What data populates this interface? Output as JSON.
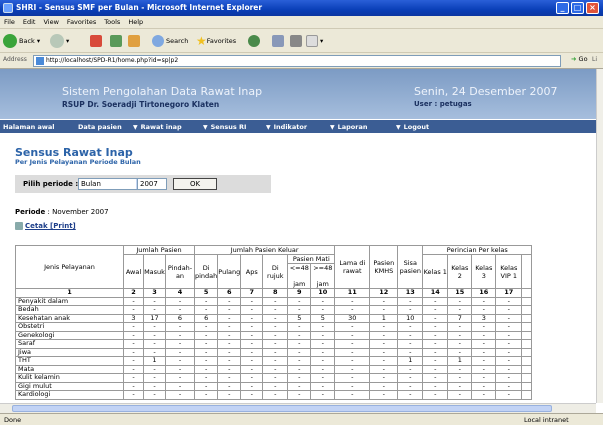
{
  "window": {
    "title": "SHRI - Sensus SMF per Bulan - Microsoft Internet Explorer"
  },
  "menu": [
    "File",
    "Edit",
    "View",
    "Favorites",
    "Tools",
    "Help"
  ],
  "toolbar": {
    "back": "Back",
    "search": "Search",
    "favorites": "Favorites"
  },
  "address": {
    "label": "Address",
    "url": "http://localhost/SPD-R1/home.php?id=sp|p2",
    "go": "Go",
    "links": "Li"
  },
  "header": {
    "title": "Sistem Pengolahan Data Rawat Inap",
    "subtitle": "RSUP Dr. Soeradji Tirtonegoro Klaten",
    "date": "Senin, 24 Desember 2007",
    "user": "User : petugas"
  },
  "nav": [
    {
      "label": "Halaman awal"
    },
    {
      "label": "Data pasien"
    },
    {
      "label": "Rawat inap"
    },
    {
      "label": "Sensus RI"
    },
    {
      "label": "Indikator"
    },
    {
      "label": "Laporan"
    },
    {
      "label": "Logout"
    }
  ],
  "page": {
    "title": "Sensus Rawat Inap",
    "subtitle": "Per Jenis Pelayanan Periode Bulan",
    "filter_label": "Pilih periode :",
    "period_value": "Bulan",
    "year_value": "2007",
    "ok": "OK",
    "periode_label": "Periode",
    "periode_value": ": November 2007",
    "print": "Cetak [Print]"
  },
  "table": {
    "h_jenis": "Jenis Pelayanan",
    "h_jumlah": "Jumlah Pasien",
    "h_keluar": "Jumlah Pasien Keluar",
    "h_mati": "Pasien Mati",
    "h_rincian": "Perincian Per kelas",
    "h_awal": "Awal",
    "h_masuk": "Masuk",
    "h_pindahan": "Pindah-an",
    "h_dipindah": "Di pindah",
    "h_pulang": "Pulang",
    "h_aps": "Aps",
    "h_dirujuk": "Di rujuk",
    "h_lt48": "<=48",
    "h_gt48": ">=48",
    "h_jam1": "jam",
    "h_jam2": "jam",
    "h_lama": "Lama di rawat",
    "h_kmhs": "Pasien KMHS",
    "h_sisa": "Sisa pasien",
    "h_k1": "Kelas 1",
    "h_k2": "Kelas 2",
    "h_k3": "Kelas 3",
    "h_vip1": "Kelas VIP 1",
    "numbers": [
      "1",
      "2",
      "3",
      "4",
      "5",
      "6",
      "7",
      "8",
      "9",
      "10",
      "11",
      "12",
      "13",
      "14",
      "15",
      "16",
      "17"
    ],
    "rows": [
      {
        "name": "Penyakit dalam",
        "v": [
          "-",
          "-",
          "-",
          "-",
          "-",
          "-",
          "-",
          "-",
          "-",
          "-",
          "-",
          "-",
          "-",
          "-",
          "-",
          "-"
        ]
      },
      {
        "name": "Bedah",
        "v": [
          "-",
          "-",
          "-",
          "-",
          "-",
          "-",
          "-",
          "-",
          "-",
          "-",
          "-",
          "-",
          "-",
          "-",
          "-",
          "-"
        ]
      },
      {
        "name": "Kesehatan anak",
        "v": [
          "3",
          "17",
          "6",
          "6",
          "-",
          "-",
          "-",
          "5",
          "5",
          "30",
          "1",
          "10",
          "-",
          "7",
          "3",
          "-"
        ]
      },
      {
        "name": "Obstetri",
        "v": [
          "-",
          "-",
          "-",
          "-",
          "-",
          "-",
          "-",
          "-",
          "-",
          "-",
          "-",
          "-",
          "-",
          "-",
          "-",
          "-"
        ]
      },
      {
        "name": "Genekologi",
        "v": [
          "-",
          "-",
          "-",
          "-",
          "-",
          "-",
          "-",
          "-",
          "-",
          "-",
          "-",
          "-",
          "-",
          "-",
          "-",
          "-"
        ]
      },
      {
        "name": "Saraf",
        "v": [
          "-",
          "-",
          "-",
          "-",
          "-",
          "-",
          "-",
          "-",
          "-",
          "-",
          "-",
          "-",
          "-",
          "-",
          "-",
          "-"
        ]
      },
      {
        "name": "Jiwa",
        "v": [
          "-",
          "-",
          "-",
          "-",
          "-",
          "-",
          "-",
          "-",
          "-",
          "-",
          "-",
          "-",
          "-",
          "-",
          "-",
          "-"
        ]
      },
      {
        "name": "THT",
        "v": [
          "-",
          "1",
          "-",
          "-",
          "-",
          "-",
          "-",
          "-",
          "-",
          "-",
          "-",
          "1",
          "-",
          "1",
          "-",
          "-"
        ]
      },
      {
        "name": "Mata",
        "v": [
          "-",
          "-",
          "-",
          "-",
          "-",
          "-",
          "-",
          "-",
          "-",
          "-",
          "-",
          "-",
          "-",
          "-",
          "-",
          "-"
        ]
      },
      {
        "name": "Kulit kelamin",
        "v": [
          "-",
          "-",
          "-",
          "-",
          "-",
          "-",
          "-",
          "-",
          "-",
          "-",
          "-",
          "-",
          "-",
          "-",
          "-",
          "-"
        ]
      },
      {
        "name": "Gigi mulut",
        "v": [
          "-",
          "-",
          "-",
          "-",
          "-",
          "-",
          "-",
          "-",
          "-",
          "-",
          "-",
          "-",
          "-",
          "-",
          "-",
          "-"
        ]
      },
      {
        "name": "Kardiologi",
        "v": [
          "-",
          "-",
          "-",
          "-",
          "-",
          "-",
          "-",
          "-",
          "-",
          "-",
          "-",
          "-",
          "-",
          "-",
          "-",
          "-"
        ]
      }
    ]
  },
  "status": {
    "left": "Done",
    "right": "Local intranet"
  }
}
